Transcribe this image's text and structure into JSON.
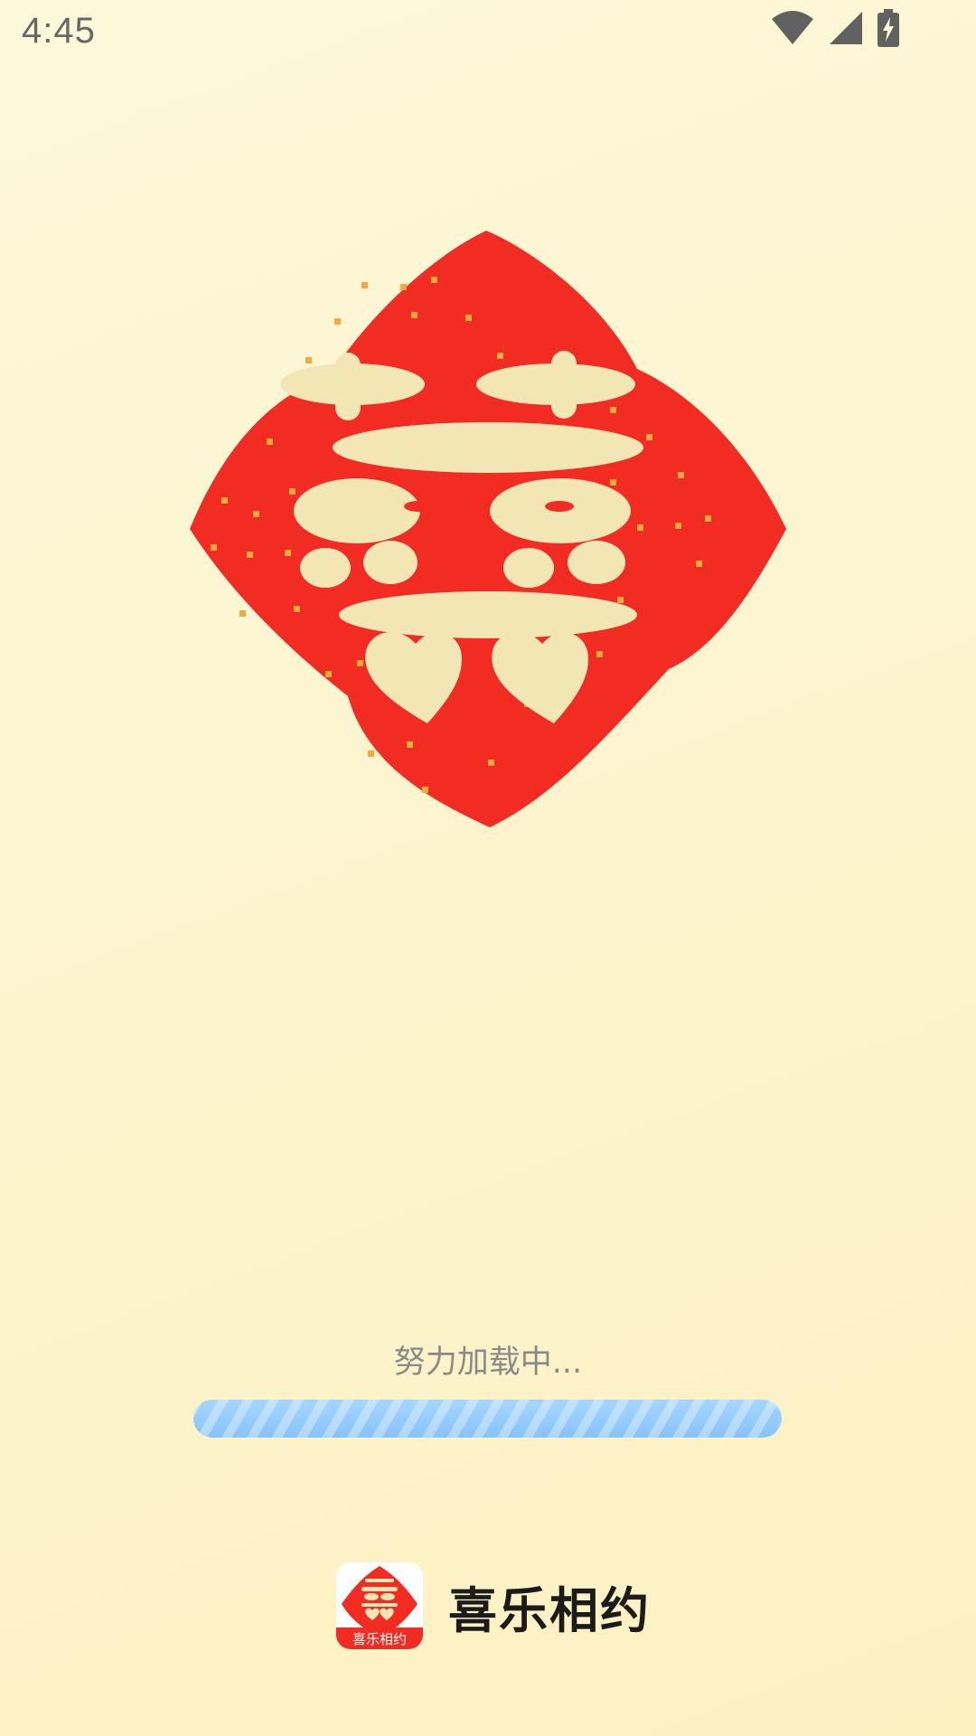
{
  "status_bar": {
    "time": "4:45",
    "icons": [
      "wifi-icon",
      "cellular-signal-icon",
      "battery-charging-icon"
    ]
  },
  "splash": {
    "emblem_icon": "double-happiness-emblem-icon",
    "emblem_colors": {
      "red": "#f22b23",
      "cream": "#f3e6b5",
      "gold": "#f5a93b"
    }
  },
  "loading": {
    "text": "努力加载中...",
    "progress": 1.0,
    "bar_color": "#8ec9fc"
  },
  "brand": {
    "logo_icon": "app-logo-icon",
    "logo_text": "喜乐相约",
    "name": "喜乐相约"
  }
}
